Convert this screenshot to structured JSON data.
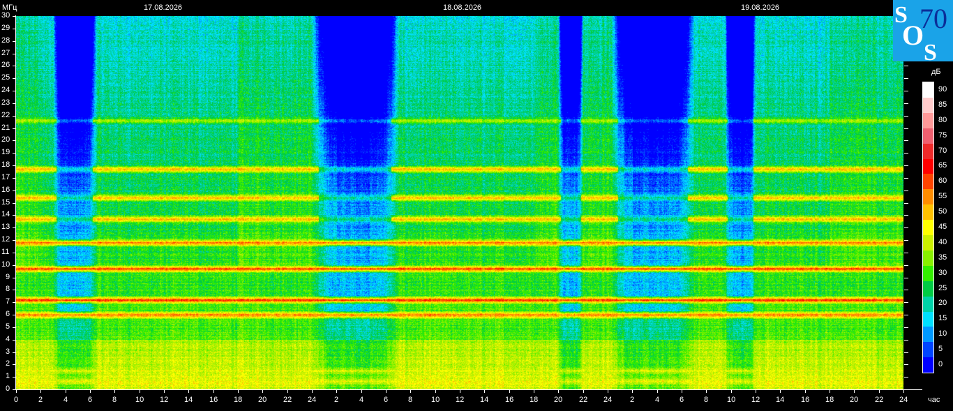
{
  "y_unit": "МГц",
  "x_unit": "час",
  "colorbar_unit": "дБ",
  "dates": [
    "17.08.2026",
    "18.08.2026",
    "19.08.2026"
  ],
  "x_tick_labels": [
    "0",
    "2",
    "4",
    "6",
    "8",
    "10",
    "12",
    "14",
    "16",
    "18",
    "20",
    "22",
    "24",
    "2",
    "4",
    "6",
    "8",
    "10",
    "12",
    "14",
    "16",
    "18",
    "20",
    "22",
    "24",
    "2",
    "4",
    "6",
    "8",
    "10",
    "12",
    "14",
    "16",
    "18",
    "20",
    "22",
    "24"
  ],
  "y_tick_labels": [
    "0",
    "1",
    "2",
    "3",
    "4",
    "5",
    "6",
    "7",
    "8",
    "9",
    "10",
    "11",
    "12",
    "13",
    "14",
    "15",
    "16",
    "17",
    "18",
    "19",
    "20",
    "21",
    "22",
    "23",
    "24",
    "25",
    "26",
    "27",
    "28",
    "29",
    "30"
  ],
  "logo": {
    "text": "SOS 70",
    "letters": [
      "S",
      "O",
      "S"
    ],
    "number": "70",
    "background": "#1aa3e8",
    "letter_color": "#ffffff",
    "number_color": "#0b2e99"
  },
  "chart_data": {
    "type": "heatmap",
    "title": "",
    "xlabel": "час",
    "ylabel": "МГц",
    "x_range_hours": [
      0,
      72
    ],
    "ylim": [
      0,
      30
    ],
    "colorbar": {
      "label": "дБ",
      "range": [
        0,
        90
      ],
      "tick_labels": [
        "0",
        "5",
        "10",
        "15",
        "20",
        "25",
        "30",
        "35",
        "40",
        "45",
        "50",
        "55",
        "60",
        "65",
        "70",
        "75",
        "80",
        "85",
        "90"
      ],
      "colors": [
        "#0000ff",
        "#0044ff",
        "#0099ff",
        "#00e1ff",
        "#00d2a8",
        "#00cc44",
        "#33ee00",
        "#88f000",
        "#ccf000",
        "#ffff00",
        "#ffc000",
        "#ff8c00",
        "#ff4400",
        "#ff0000",
        "#ee2a2a",
        "#f06070",
        "#ff9999",
        "#ffcccc",
        "#ffffff"
      ]
    },
    "day_segments": [
      {
        "date": "17.08.2026",
        "start_hour": 0,
        "end_hour": 24
      },
      {
        "date": "18.08.2026",
        "start_hour": 24,
        "end_hour": 48
      },
      {
        "date": "19.08.2026",
        "start_hour": 48,
        "end_hour": 72
      }
    ],
    "persistent_bands_mhz": [
      {
        "freq": 0.7,
        "level_db": 45
      },
      {
        "freq": 1.5,
        "level_db": 45
      },
      {
        "freq": 6.0,
        "level_db": 60
      },
      {
        "freq": 7.2,
        "level_db": 65
      },
      {
        "freq": 9.7,
        "level_db": 65
      },
      {
        "freq": 11.8,
        "level_db": 60
      },
      {
        "freq": 13.7,
        "level_db": 55
      },
      {
        "freq": 15.4,
        "level_db": 55
      },
      {
        "freq": 17.7,
        "level_db": 55
      },
      {
        "freq": 21.6,
        "level_db": 40
      }
    ],
    "nighttime_quiet_hours": [
      [
        3,
        6.5
      ],
      [
        24,
        31
      ],
      [
        44,
        46
      ],
      [
        48.3,
        55
      ],
      [
        57.5,
        60
      ]
    ]
  }
}
